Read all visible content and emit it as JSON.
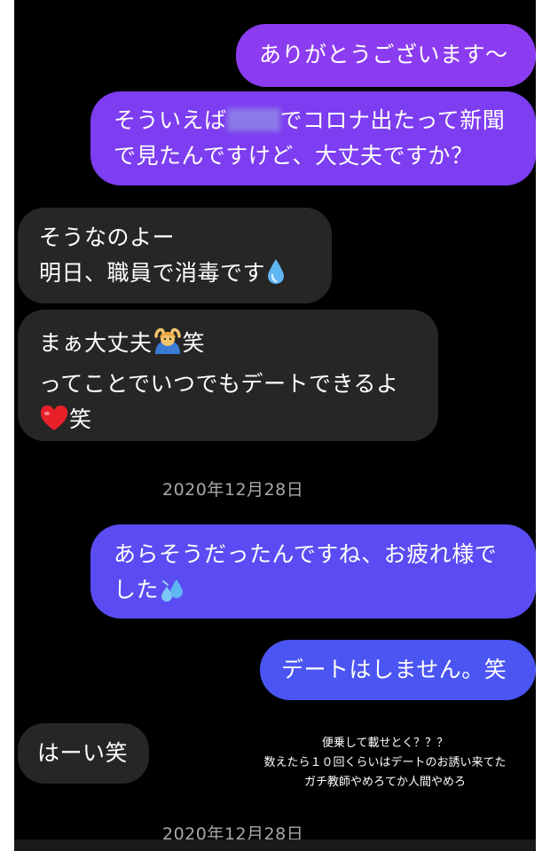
{
  "messages": [
    {
      "lines": [
        "ありがとうございます〜"
      ]
    },
    {
      "line1_before": "そういえば",
      "line1_after": "でコロナ出たって新聞",
      "line2": "で見たんですけど、大丈夫ですか？"
    },
    {
      "lines": [
        "そうなのよー",
        "明日、職員で消毒です"
      ],
      "emoji": "droplet-icon"
    },
    {
      "line1": "まぁ大丈夫",
      "line1_suffix": "笑",
      "line2": "ってことでいつでもデートできるよ",
      "line3": "笑",
      "emojis": [
        "person-gesturing-ok-icon",
        "red-heart-icon"
      ]
    },
    {
      "lines": [
        "あらそうだったんですね、お疲れ様で",
        "した"
      ],
      "emoji": "sweat-droplets-icon"
    },
    {
      "lines": [
        "デートはしません。笑"
      ]
    },
    {
      "lines": [
        "はーい笑"
      ]
    }
  ],
  "dates": [
    "2020年12月28日",
    "2020年12月28日"
  ],
  "caption": [
    "便乗して載せとく？？？",
    "数えたら１０回くらいはデートのお誘い来てた",
    "ガチ教師やめろてか人間やめろ"
  ],
  "colors": {
    "background": "#000000",
    "incoming": "#262626",
    "outgoing_top": "#8a3df0",
    "outgoing_mid": "#6c40f0",
    "outgoing_bottom": "#4a55f2",
    "date_text": "#a8a8a8"
  }
}
